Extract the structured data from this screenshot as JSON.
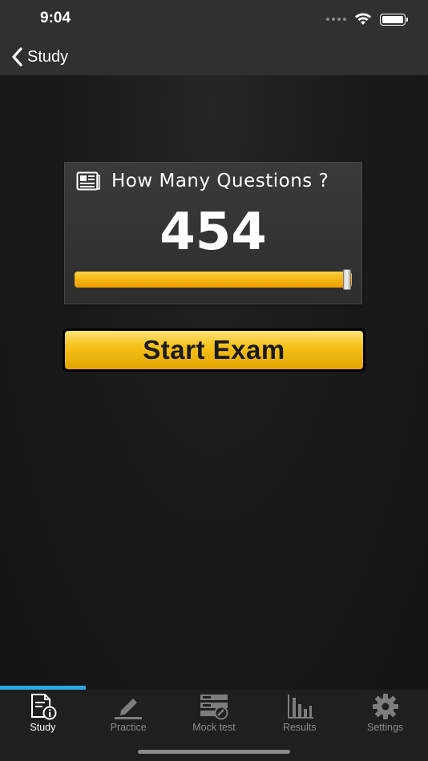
{
  "status_bar": {
    "time": "9:04",
    "icons": [
      "signal-dots-icon",
      "wifi-icon",
      "battery-icon"
    ]
  },
  "nav": {
    "back_label": "Study",
    "back_icon": "chevron-left-icon"
  },
  "question_panel": {
    "icon": "newspaper-icon",
    "title": "How Many Questions ?",
    "count": "454",
    "slider_fraction": 1.0
  },
  "start_button": {
    "label": "Start Exam"
  },
  "tabs": [
    {
      "label": "Study",
      "icon": "study-doc-info-icon",
      "active": true
    },
    {
      "label": "Practice",
      "icon": "pencil-icon",
      "active": false
    },
    {
      "label": "Mock test",
      "icon": "mock-test-icon",
      "active": false
    },
    {
      "label": "Results",
      "icon": "bar-chart-icon",
      "active": false
    },
    {
      "label": "Settings",
      "icon": "gear-icon",
      "active": false
    }
  ],
  "colors": {
    "accent": "#2aa7e4",
    "slider": "#f6b20f",
    "button": "#f5c21a"
  }
}
